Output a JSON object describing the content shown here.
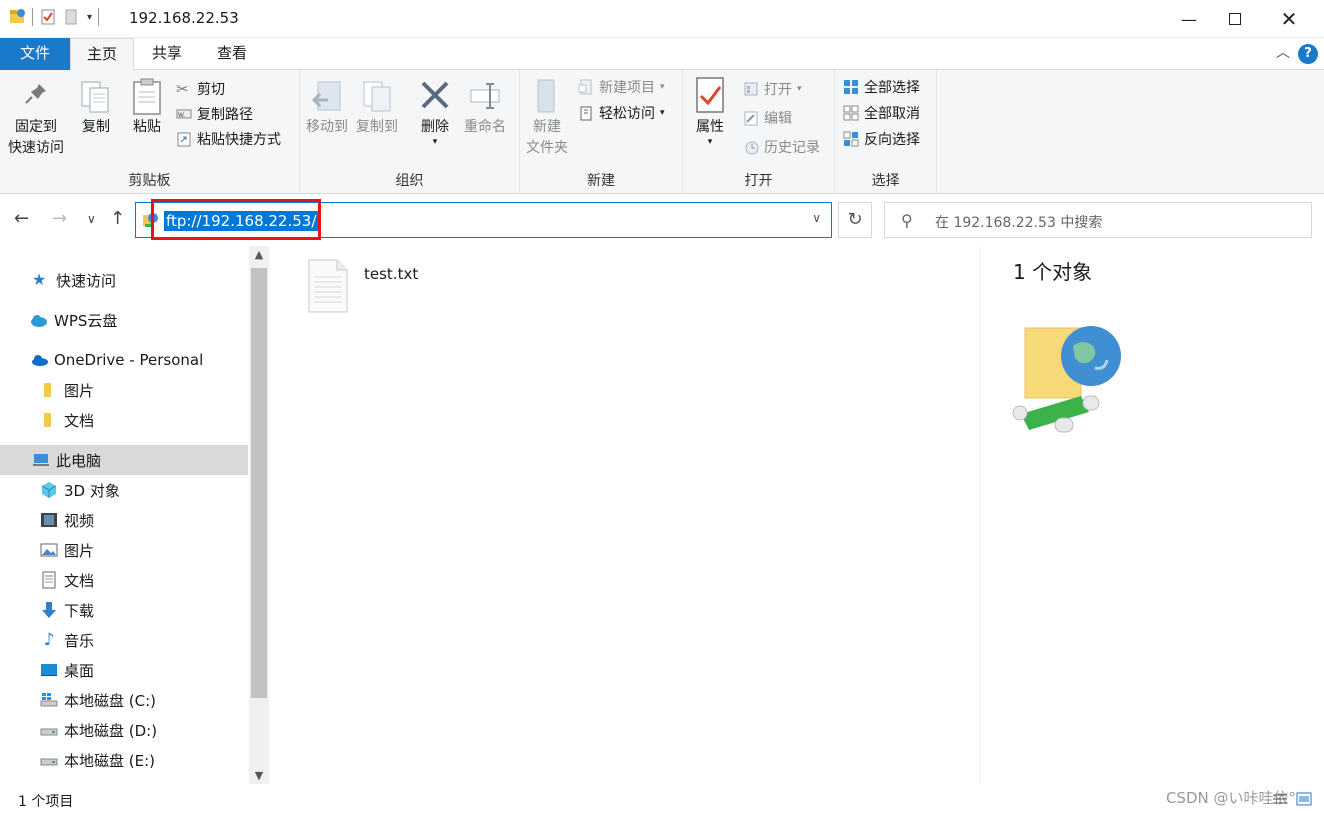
{
  "window": {
    "title": "192.168.22.53",
    "minimize_icon": "minimize-icon",
    "maximize_icon": "maximize-icon",
    "close_icon": "close-icon"
  },
  "tabs": [
    {
      "label": "文件"
    },
    {
      "label": "主页"
    },
    {
      "label": "共享"
    },
    {
      "label": "查看"
    }
  ],
  "ribbon": {
    "clipboard": {
      "label": "剪贴板",
      "pin": "固定到\n快速访问",
      "copy": "复制",
      "paste": "粘贴",
      "cut": "剪切",
      "copy_path": "复制路径",
      "paste_shortcut": "粘贴快捷方式"
    },
    "organize": {
      "label": "组织",
      "move_to": "移动到",
      "copy_to": "复制到",
      "delete": "删除",
      "rename": "重命名"
    },
    "new": {
      "label": "新建",
      "new_folder": "新建\n文件夹",
      "new_item": "新建项目",
      "easy_access": "轻松访问"
    },
    "open": {
      "label": "打开",
      "properties": "属性",
      "open": "打开",
      "edit": "编辑",
      "history": "历史记录"
    },
    "select": {
      "label": "选择",
      "select_all": "全部选择",
      "select_none": "全部取消",
      "invert": "反向选择"
    }
  },
  "address": {
    "value": "ftp://192.168.22.53/",
    "search_placeholder": "在 192.168.22.53 中搜索"
  },
  "sidebar": {
    "items": [
      {
        "label": "快速访问",
        "icon": "star-icon"
      },
      {
        "label": "WPS云盘",
        "icon": "cloud-icon"
      },
      {
        "label": "OneDrive - Personal",
        "icon": "onedrive-icon"
      },
      {
        "label": "图片",
        "icon": "folder-icon"
      },
      {
        "label": "文档",
        "icon": "folder-icon"
      },
      {
        "label": "此电脑",
        "icon": "computer-icon"
      },
      {
        "label": "3D 对象",
        "icon": "3d-objects-icon"
      },
      {
        "label": "视频",
        "icon": "video-icon"
      },
      {
        "label": "图片",
        "icon": "pictures-icon"
      },
      {
        "label": "文档",
        "icon": "documents-icon"
      },
      {
        "label": "下载",
        "icon": "download-icon"
      },
      {
        "label": "音乐",
        "icon": "music-icon"
      },
      {
        "label": "桌面",
        "icon": "desktop-icon"
      },
      {
        "label": "本地磁盘 (C:)",
        "icon": "drive-c-icon"
      },
      {
        "label": "本地磁盘 (D:)",
        "icon": "drive-icon"
      },
      {
        "label": "本地磁盘 (E:)",
        "icon": "drive-icon"
      }
    ]
  },
  "files": [
    {
      "name": "test.txt",
      "icon": "text-file-icon"
    }
  ],
  "preview": {
    "count": "1 个对象"
  },
  "status": {
    "items": "1 个项目",
    "watermark": "CSDN @い咔哇依°"
  },
  "colors": {
    "accent": "#0078d7",
    "file_tab": "#1979ca",
    "highlight_box": "#e8121b"
  }
}
